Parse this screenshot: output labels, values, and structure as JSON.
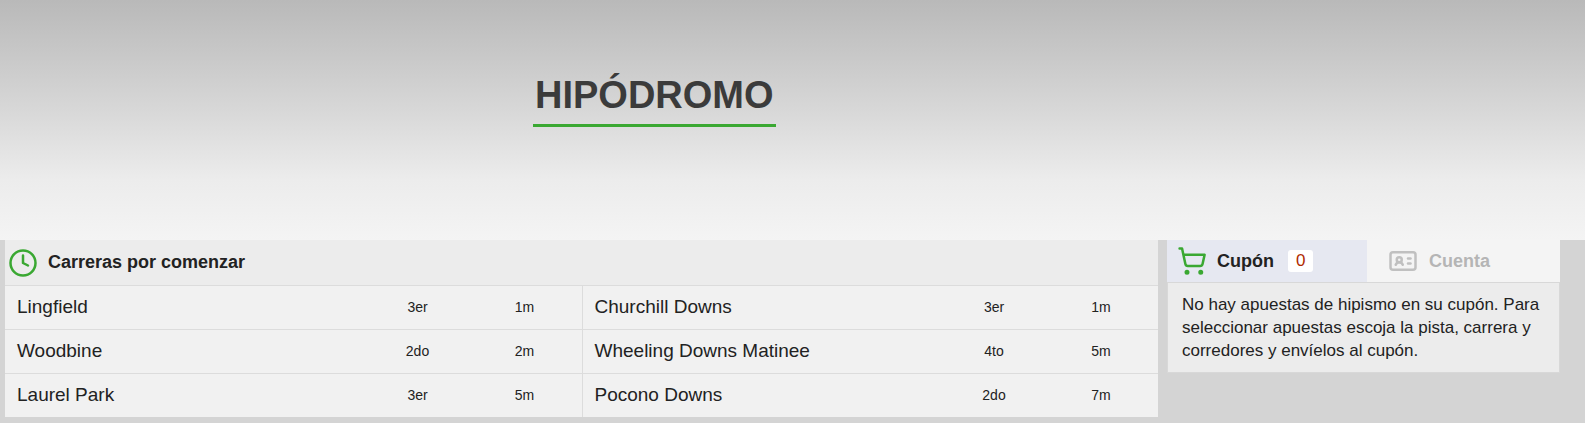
{
  "page": {
    "title": "HIPÓDROMO"
  },
  "upcoming": {
    "title": "Carreras por comenzar",
    "races": [
      {
        "track": "Lingfield",
        "race": "3er",
        "time": "1m"
      },
      {
        "track": "Churchill Downs",
        "race": "3er",
        "time": "1m"
      },
      {
        "track": "Woodbine",
        "race": "2do",
        "time": "2m"
      },
      {
        "track": "Wheeling Downs Matinee",
        "race": "4to",
        "time": "5m"
      },
      {
        "track": "Laurel Park",
        "race": "3er",
        "time": "5m"
      },
      {
        "track": "Pocono Downs",
        "race": "2do",
        "time": "7m"
      }
    ]
  },
  "coupon": {
    "tabs": [
      {
        "label": "Cupón",
        "selected": true,
        "count": "0"
      },
      {
        "label": "Cuenta",
        "selected": false
      }
    ],
    "message": "No hay apuestas de hipismo en su cupón. Para seleccionar apuestas escoja la pista, carrera y corredores y envíelos al cupón."
  }
}
